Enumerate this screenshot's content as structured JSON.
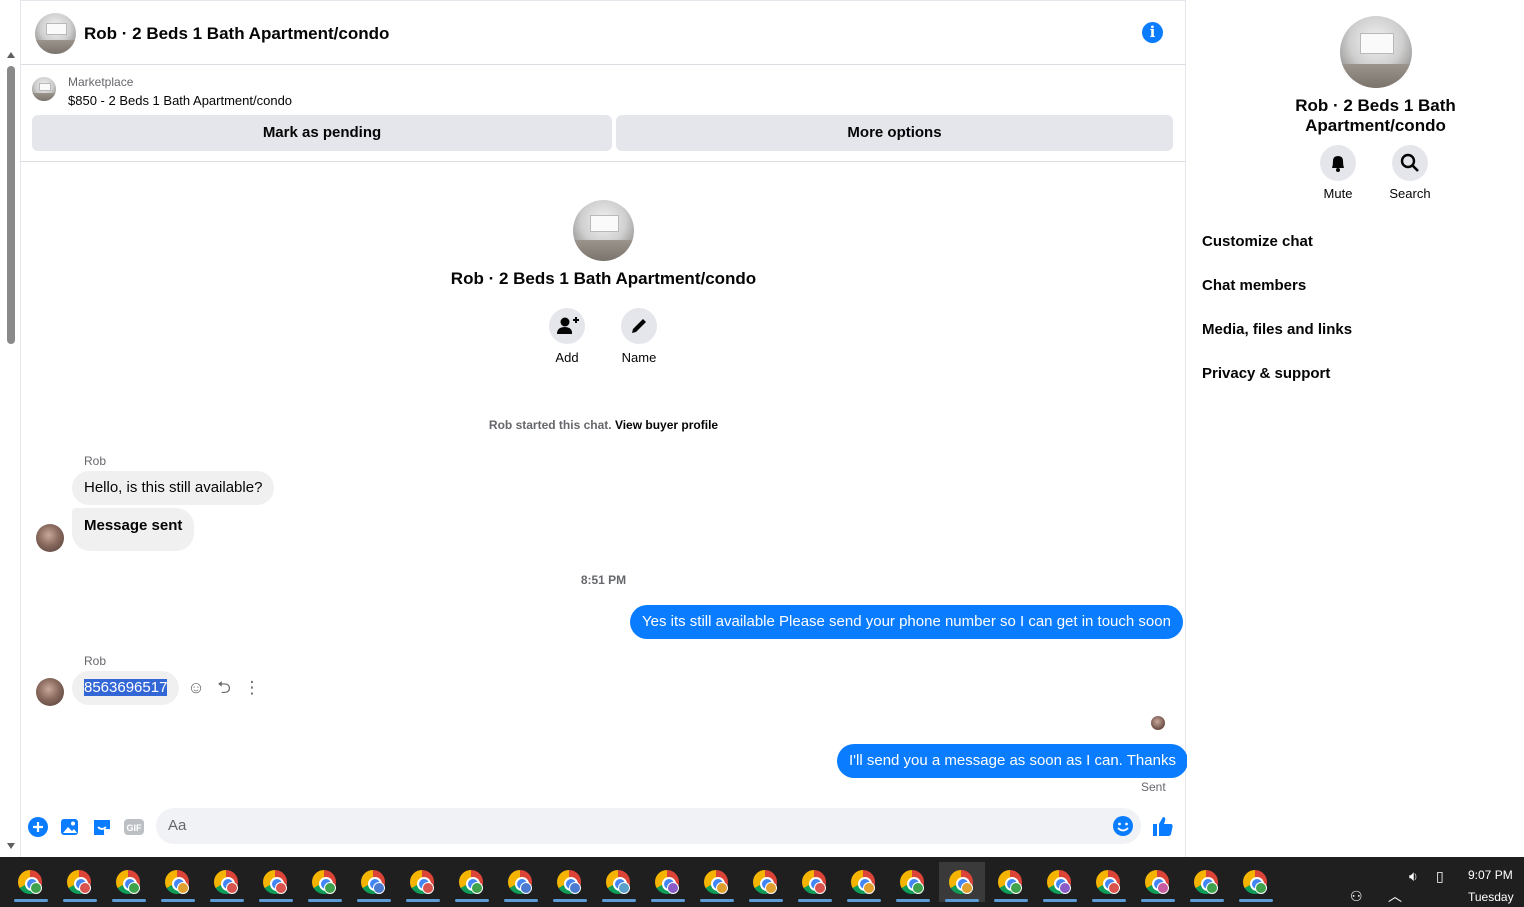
{
  "chat": {
    "title": "Rob · 2 Beds 1 Bath Apartment/condo",
    "marketplace_label": "Marketplace",
    "listing": "$850 - 2 Beds 1 Bath Apartment/condo",
    "pending_label": "Mark as pending",
    "more_options_label": "More options",
    "intro_name": "Rob · 2 Beds 1 Bath Apartment/condo",
    "add_label": "Add",
    "name_label": "Name",
    "started_text": "Rob started this chat.",
    "buyer_profile_link": "View buyer profile",
    "timestamp": "8:51 PM",
    "sent_label": "Sent",
    "composer_placeholder": "Aa"
  },
  "messages": [
    {
      "sender": "Rob",
      "text": "Hello, is this still available?"
    },
    {
      "sender": "Rob",
      "text": "Message sent"
    },
    {
      "sender": "me",
      "text": "Yes its still available Please send your phone number so I can get in touch soon"
    },
    {
      "sender": "Rob",
      "text": "8563696517"
    },
    {
      "sender": "me",
      "text": "I'll send you a message as soon as I can. Thanks"
    }
  ],
  "panel": {
    "title": "Rob · 2 Beds 1 Bath Apartment/condo",
    "mute_label": "Mute",
    "search_label": "Search",
    "items": [
      "Customize chat",
      "Chat members",
      "Media, files and links",
      "Privacy & support"
    ]
  },
  "taskbar": {
    "time": "9:07 PM",
    "day": "Tuesday"
  },
  "colors": {
    "accent": "#0a7cff",
    "bubble_in": "#f0f0f0",
    "button_gray": "#e4e6eb",
    "taskbar": "#1f1f1f"
  }
}
